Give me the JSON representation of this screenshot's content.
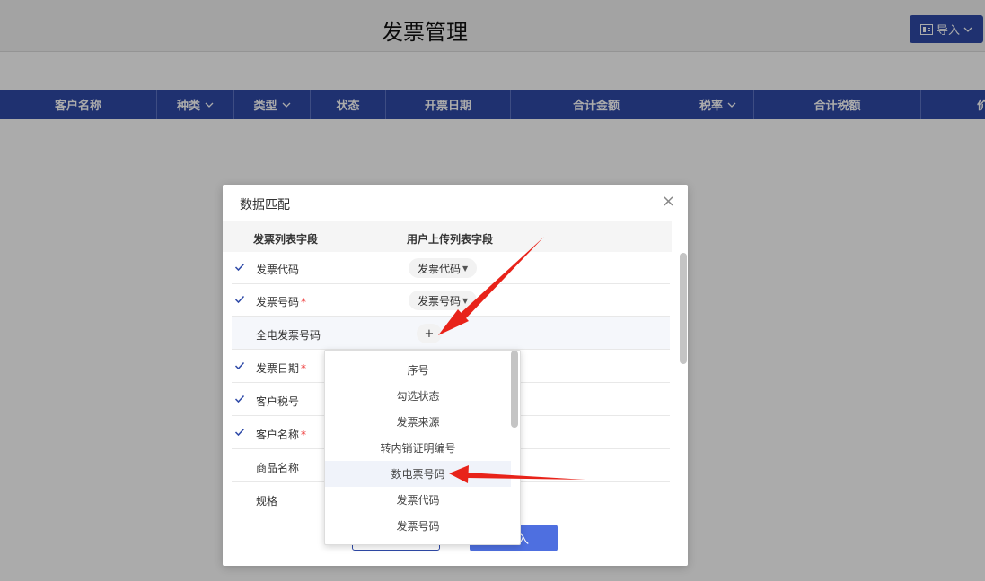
{
  "page": {
    "title": "发票管理"
  },
  "toolbar": {
    "import_label": "导入"
  },
  "table": {
    "columns": [
      {
        "label": "客户名称",
        "dropdown": false
      },
      {
        "label": "种类",
        "dropdown": true
      },
      {
        "label": "类型",
        "dropdown": true
      },
      {
        "label": "状态",
        "dropdown": false
      },
      {
        "label": "开票日期",
        "dropdown": false
      },
      {
        "label": "合计金额",
        "dropdown": false
      },
      {
        "label": "税率",
        "dropdown": true
      },
      {
        "label": "合计税额",
        "dropdown": false
      },
      {
        "label": "价",
        "dropdown": false
      }
    ]
  },
  "modal": {
    "title": "数据匹配",
    "close": "×",
    "col_invoice_field": "发票列表字段",
    "col_upload_field": "用户上传列表字段",
    "rows": [
      {
        "label": "发票代码",
        "checked": true,
        "required": false,
        "mapped": "发票代码"
      },
      {
        "label": "发票号码",
        "checked": true,
        "required": true,
        "mapped": "发票号码"
      },
      {
        "label": "全电发票号码",
        "checked": false,
        "required": false,
        "mapped": "+"
      },
      {
        "label": "发票日期",
        "checked": true,
        "required": true,
        "mapped": ""
      },
      {
        "label": "客户税号",
        "checked": true,
        "required": false,
        "mapped": ""
      },
      {
        "label": "客户名称",
        "checked": true,
        "required": true,
        "mapped": ""
      },
      {
        "label": "商品名称",
        "checked": false,
        "required": false,
        "mapped": ""
      },
      {
        "label": "规格",
        "checked": false,
        "required": false,
        "mapped": ""
      }
    ],
    "required_mark": "*",
    "confirm_label": "入"
  },
  "dropdown": {
    "items": [
      "序号",
      "勾选状态",
      "发票来源",
      "转内销证明编号",
      "数电票号码",
      "发票代码",
      "发票号码"
    ],
    "selected_index": 4
  },
  "colors": {
    "primary": "#2f4aa8",
    "annotation_arrow": "#e8231a",
    "required": "#e33333"
  }
}
